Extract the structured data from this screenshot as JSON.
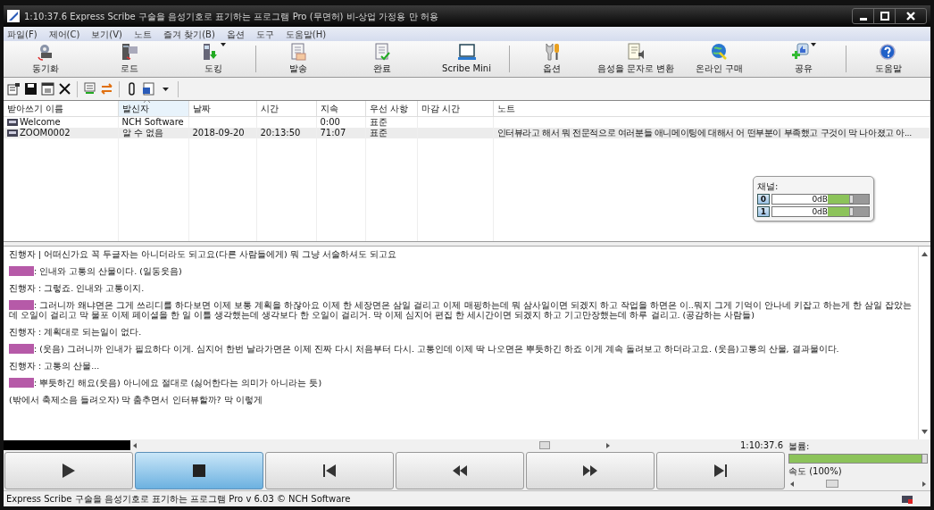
{
  "window": {
    "title": "1:10:37.6 Express Scribe 구술을 음성기호로 표기하는 프로그램 Pro (무면허) 비-상업 가정용 만 허용"
  },
  "menu": [
    "파일(F)",
    "제어(C)",
    "보기(V)",
    "노트",
    "즐겨 찾기(B)",
    "옵션",
    "도구",
    "도움말(H)"
  ],
  "toolbar": [
    {
      "kind": "sync",
      "label": "동기화",
      "has_menu": false
    },
    {
      "kind": "load",
      "label": "로드",
      "has_menu": false
    },
    {
      "kind": "dock",
      "label": "도킹",
      "has_menu": true
    },
    {
      "kind": "send",
      "label": "발송",
      "has_menu": false
    },
    {
      "kind": "done",
      "label": "완료",
      "has_menu": false
    },
    {
      "kind": "mini",
      "label": "Scribe Mini",
      "has_menu": false
    },
    {
      "kind": "options",
      "label": "옵션",
      "has_menu": false
    },
    {
      "kind": "speech",
      "label": "음성을 문자로 변환",
      "has_menu": false
    },
    {
      "kind": "buy",
      "label": "온라인 구매",
      "has_menu": false
    },
    {
      "kind": "share",
      "label": "공유",
      "has_menu": true
    },
    {
      "kind": "help",
      "label": "도움말",
      "has_menu": false
    }
  ],
  "table": {
    "columns": [
      {
        "label": "받아쓰기 이름",
        "sorted": false
      },
      {
        "label": "발신자",
        "sorted": true
      },
      {
        "label": "날짜",
        "sorted": false
      },
      {
        "label": "시간",
        "sorted": false
      },
      {
        "label": "지속",
        "sorted": false
      },
      {
        "label": "우선 사항",
        "sorted": false
      },
      {
        "label": "마감 시간",
        "sorted": false
      },
      {
        "label": "노트",
        "sorted": false
      }
    ],
    "rows": [
      {
        "selected": false,
        "cells": [
          "Welcome",
          "NCH Software",
          "",
          "",
          "0:00",
          "표준",
          "",
          ""
        ]
      },
      {
        "selected": true,
        "cells": [
          "ZOOM0002",
          "알 수 없음",
          "2018-09-20",
          "20:13:50",
          "71:07",
          "표준",
          "",
          "인터뷰라고 해서 뭐 전문적으로 여러분들 애니메이팅에 대해서 어 떤부분이 부족했고 구것이 막 나아졌고 아..."
        ]
      }
    ]
  },
  "channels": {
    "title": "채널:",
    "items": [
      {
        "label": "0",
        "reading": "0dB",
        "level": 0.8
      },
      {
        "label": "1",
        "reading": "0dB",
        "level": 0.8
      }
    ]
  },
  "transcript": [
    {
      "redacted": false,
      "text": "진행자 | 어떠신가요 꼭 두글자는 아니더라도 되고요(다른 사람들에게) 뭐 그냥 서술하셔도 되고요"
    },
    {
      "redacted": true,
      "text": ": 인내와 고통의 산물이다. (일동웃음)"
    },
    {
      "redacted": false,
      "text": "진행자 : 그렇죠. 인내와 고통이지."
    },
    {
      "redacted": true,
      "text": ": 그러니까 왜냐면은 그게 쓰리디를 하다보면 이제 보통 계획을 하잖아요 이제 한 세장면은 삼일 걸리고 이제 매핑하는데 뭐 삼사일이면 되겠지 하고 작업을 하면은 이..뭐지 그게 기억이 안나네 키잡고 하는게 한 삼일 잡았는데 오일이 걸리고 막 물포 이제 페이셜을 한 일 이틀 생각했는데 생각보다 한 오일이 걸리거. 막 이제 심지어 편집 한 세시간이면 되겠지 하고 기고만장했는데 하루 걸리고. (공감하는 사람들)"
    },
    {
      "redacted": false,
      "text": "진행자 : 계획대로 되는일이 없다."
    },
    {
      "redacted": true,
      "text": ": (웃음) 그러니까 인내가 필요하다 이게. 심지어 한번 날라가면은 이제 진짜 다시 처음부터 다시. 고통인데 이제 딱 나오면은 뿌듯하긴 하죠 이게 계속 돌려보고 하더라고요. (웃음)고통의 산물, 결과물이다."
    },
    {
      "redacted": false,
      "text": "진행자 : 고통의 산물..."
    },
    {
      "redacted": true,
      "text": ": 뿌듯하긴 해요(웃음) 아니에요 절대로 (싫어한다는 의미가 아니라는 듯)"
    },
    {
      "redacted": false,
      "text": "(밖에서 축제소음 들려오자) 막 춤추면서 인터뷰할까? 막 이렇게"
    }
  ],
  "position": {
    "level": 0.87,
    "time": "1:10:37.6"
  },
  "transport": [
    {
      "kind": "play",
      "selected": false
    },
    {
      "kind": "stop",
      "selected": true
    },
    {
      "kind": "start",
      "selected": false
    },
    {
      "kind": "rewind",
      "selected": false
    },
    {
      "kind": "forward",
      "selected": false
    },
    {
      "kind": "end",
      "selected": false
    }
  ],
  "volume": {
    "label": "볼륨:",
    "level": 1.0
  },
  "speed": {
    "label": "속도 (100%)",
    "level": 0.3
  },
  "status_bar": {
    "text": "Express Scribe 구술을 음성기호로 표기하는 프로그램 Pro v 6.03 © NCH Software"
  }
}
